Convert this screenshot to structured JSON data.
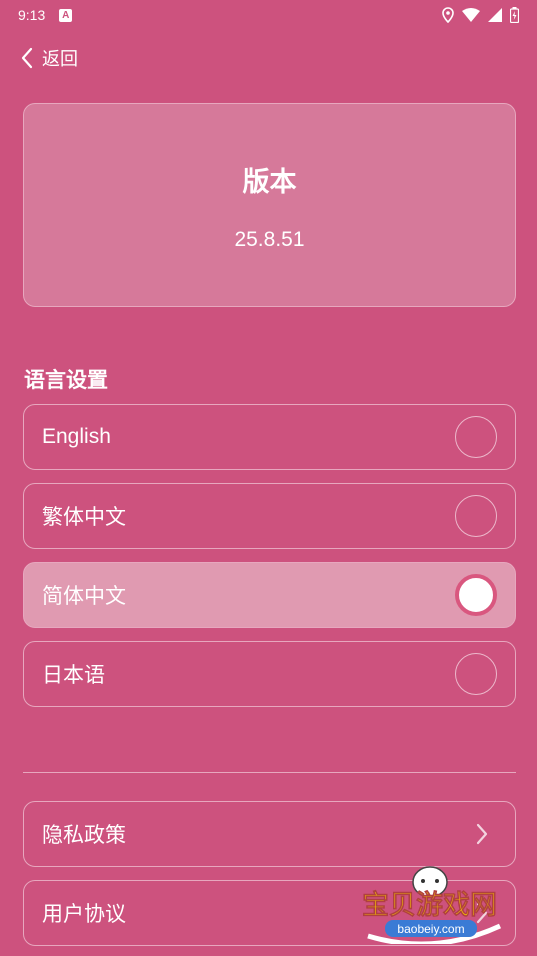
{
  "status_bar": {
    "time": "9:13",
    "icons": [
      "a-icon",
      "location-icon",
      "wifi-icon",
      "signal-icon",
      "battery-icon"
    ]
  },
  "header": {
    "back_label": "返回",
    "back_icon": "chevron-left-icon"
  },
  "version_card": {
    "title": "版本",
    "version": "25.8.51"
  },
  "language_section": {
    "title": "语言设置",
    "options": [
      {
        "label": "English",
        "selected": false
      },
      {
        "label": "繁体中文",
        "selected": false
      },
      {
        "label": "简体中文",
        "selected": true
      },
      {
        "label": "日本语",
        "selected": false
      }
    ]
  },
  "links": [
    {
      "label": "隐私政策",
      "icon": "chevron-right-icon"
    },
    {
      "label": "用户协议",
      "icon": "chevron-right-icon"
    }
  ],
  "watermark": {
    "title": "宝贝游戏网",
    "domain": "baobeiy.com"
  },
  "colors": {
    "background": "#CD527E",
    "card": "#D6799A",
    "selected_option": "#E09AB1",
    "border": "#E7A7BE",
    "radio_ring_on": "#D9577F"
  }
}
